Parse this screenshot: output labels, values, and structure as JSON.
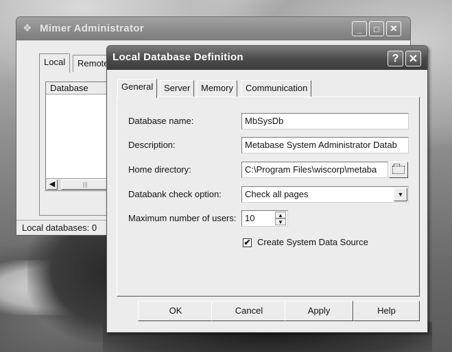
{
  "back_window": {
    "title": "Mimer Administrator",
    "tabs": [
      "Local",
      "Remote"
    ],
    "list_header": "Database",
    "status": "Local databases: 0",
    "minimize": "_",
    "maximize": "□",
    "close": "✕"
  },
  "dialog": {
    "title": "Local Database Definition",
    "help": "?",
    "close": "✕",
    "tabs": [
      "General",
      "Server",
      "Memory",
      "Communication"
    ],
    "active_tab": "General",
    "fields": {
      "database_name": {
        "label": "Database name:",
        "value": "MbSysDb"
      },
      "description": {
        "label": "Description:",
        "value": "Metabase System Administrator Datab"
      },
      "home_directory": {
        "label": "Home directory:",
        "value": "C:\\Program Files\\wiscorp\\metaba"
      },
      "databank_check": {
        "label": "Databank check option:",
        "value": "Check all pages"
      },
      "max_users": {
        "label": "Maximum number of users:",
        "value": "10"
      },
      "create_dsn": {
        "label": "Create System Data Source",
        "checked": true,
        "mark": "✔"
      }
    },
    "buttons": {
      "ok": "OK",
      "cancel": "Cancel",
      "apply": "Apply",
      "help": "Help"
    }
  }
}
